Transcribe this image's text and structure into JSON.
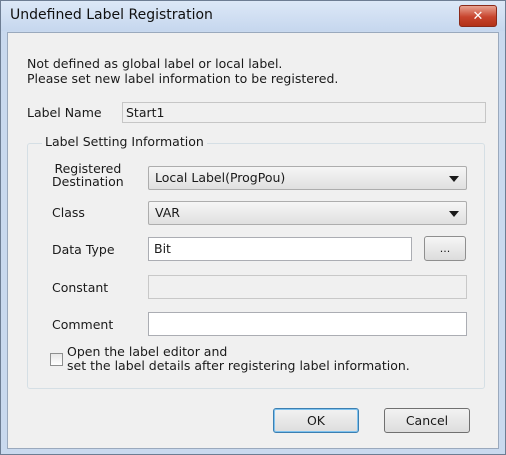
{
  "window": {
    "title": "Undefined Label Registration",
    "close_glyph": "✕"
  },
  "message": {
    "line1": "Not defined as global label or local label.",
    "line2": "Please set new label information to be registered."
  },
  "label_name": {
    "label": "Label Name",
    "value": "Start1"
  },
  "settings": {
    "group_title": "Label Setting Information",
    "registered_destination": {
      "label_line1": "Registered",
      "label_line2": "Destination",
      "value": "Local Label(ProgPou)"
    },
    "class": {
      "label": "Class",
      "value": "VAR"
    },
    "data_type": {
      "label": "Data Type",
      "value": "Bit",
      "browse_label": "..."
    },
    "constant": {
      "label": "Constant",
      "value": ""
    },
    "comment": {
      "label": "Comment",
      "value": ""
    },
    "open_editor": {
      "line1": "Open the label editor and",
      "line2": "set the label details after registering label information.",
      "checked": false
    }
  },
  "buttons": {
    "ok": "OK",
    "cancel": "Cancel"
  },
  "colors": {
    "titlebar": "#c6d7ee",
    "close_button": "#c7442d",
    "client_background": "#f0f0f0"
  }
}
